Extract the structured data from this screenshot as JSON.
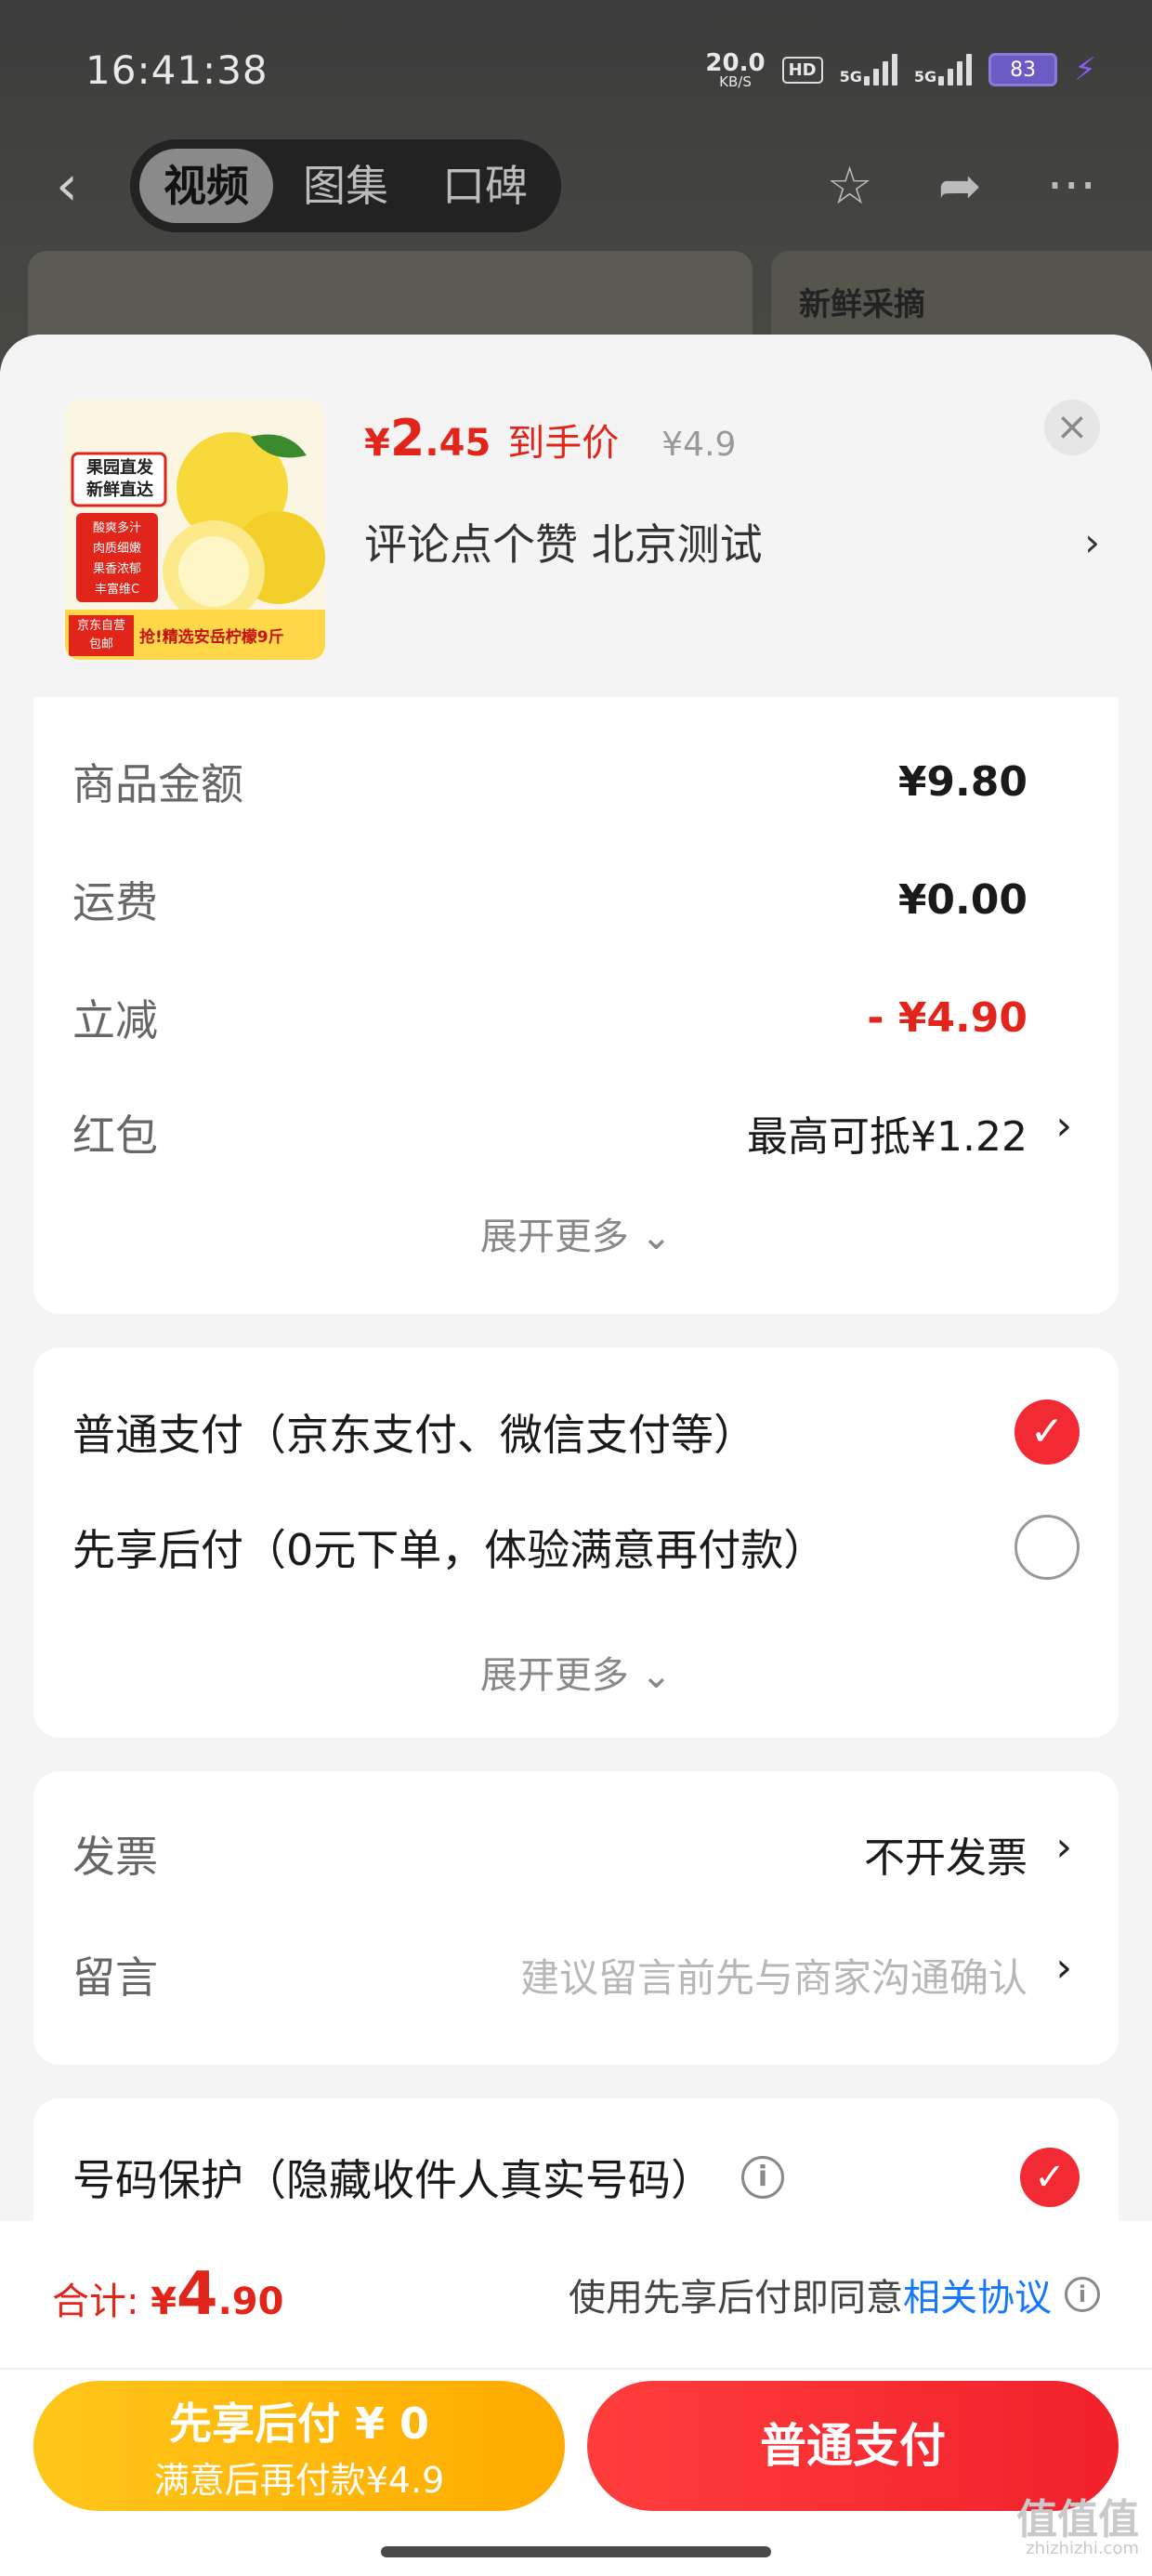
{
  "status_bar": {
    "time": "16:41:38",
    "net_speed": "20.0",
    "net_unit": "KB/S",
    "hd_badge": "HD",
    "signal1": "5G",
    "signal2": "5G",
    "battery": "83"
  },
  "top_nav": {
    "tabs": [
      {
        "label": "视频",
        "active": true
      },
      {
        "label": "图集",
        "active": false
      },
      {
        "label": "口碑",
        "active": false
      }
    ],
    "bg_card_text": "新鲜采摘"
  },
  "product": {
    "thumb_lines": [
      "果园直发",
      "新鲜直达"
    ],
    "thumb_tags": [
      "酸爽多汁",
      "肉质细嫩",
      "果香浓郁",
      "丰富维C"
    ],
    "thumb_badge": "京东自营 包邮",
    "thumb_banner": "抢!精选安岳柠檬9斤",
    "price_symbol": "¥",
    "price_int": "2",
    "price_dec": ".45",
    "price_tag": "到手价",
    "price_original": "¥4.9",
    "spec": "评论点个赞  北京测试"
  },
  "cost": {
    "rows": [
      {
        "label": "商品金额",
        "value": "¥9.80"
      },
      {
        "label": "运费",
        "value": "¥0.00"
      },
      {
        "label": "立减",
        "value": "- ¥4.90"
      },
      {
        "label": "红包",
        "value": "最高可抵¥1.22"
      }
    ],
    "expand": "展开更多"
  },
  "payment": {
    "options": [
      {
        "label": "普通支付（京东支付、微信支付等）",
        "selected": true
      },
      {
        "label": "先享后付（0元下单，体验满意再付款）",
        "selected": false
      }
    ],
    "expand": "展开更多"
  },
  "extra": {
    "invoice_label": "发票",
    "invoice_value": "不开发票",
    "note_label": "留言",
    "note_placeholder": "建议留言前先与商家沟通确认"
  },
  "privacy": {
    "label": "号码保护（隐藏收件人真实号码）",
    "checked": true
  },
  "footer": {
    "total_label": "合计:",
    "total_symbol": "¥",
    "total_int": "4",
    "total_dec": ".90",
    "agree_text": "使用先享后付即同意",
    "agree_link": "相关协议",
    "later_line1": "先享后付 ¥ 0",
    "later_line2": "满意后再付款¥4.9",
    "pay_label": "普通支付"
  },
  "watermark": {
    "text": "值值值",
    "sub": "zhizhizhi.com"
  },
  "colors": {
    "accent_red": "#e1251b",
    "link_blue": "#1677ff",
    "later_yellow": "#ffb800"
  }
}
